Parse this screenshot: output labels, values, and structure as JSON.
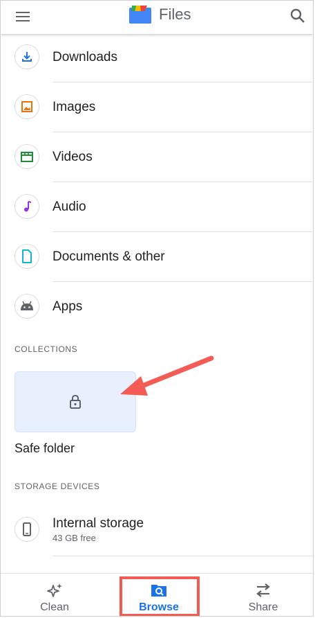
{
  "app": {
    "title": "Files"
  },
  "categories": [
    {
      "label": "Downloads",
      "icon": "download-icon",
      "color": "#1a73e8"
    },
    {
      "label": "Images",
      "icon": "image-icon",
      "color": "#e8710a"
    },
    {
      "label": "Videos",
      "icon": "video-icon",
      "color": "#1e8e3e"
    },
    {
      "label": "Audio",
      "icon": "music-note-icon",
      "color": "#9334e6"
    },
    {
      "label": "Documents & other",
      "icon": "document-icon",
      "color": "#12b5cb"
    },
    {
      "label": "Apps",
      "icon": "android-icon",
      "color": "#5f6368"
    }
  ],
  "collections": {
    "header": "COLLECTIONS",
    "safe_folder": {
      "label": "Safe folder",
      "icon": "lock-icon"
    }
  },
  "storage": {
    "header": "STORAGE DEVICES",
    "devices": [
      {
        "name": "Internal storage",
        "free": "43 GB free",
        "icon": "phone-icon"
      }
    ]
  },
  "bottom_nav": {
    "items": [
      {
        "label": "Clean",
        "icon": "sparkle-icon",
        "active": false
      },
      {
        "label": "Browse",
        "icon": "folder-search-icon",
        "active": true
      },
      {
        "label": "Share",
        "icon": "swap-arrows-icon",
        "active": false
      }
    ]
  },
  "colors": {
    "accent": "#1a73e8",
    "annotation": "#f25c54",
    "card_bg": "#e8f0fe"
  }
}
